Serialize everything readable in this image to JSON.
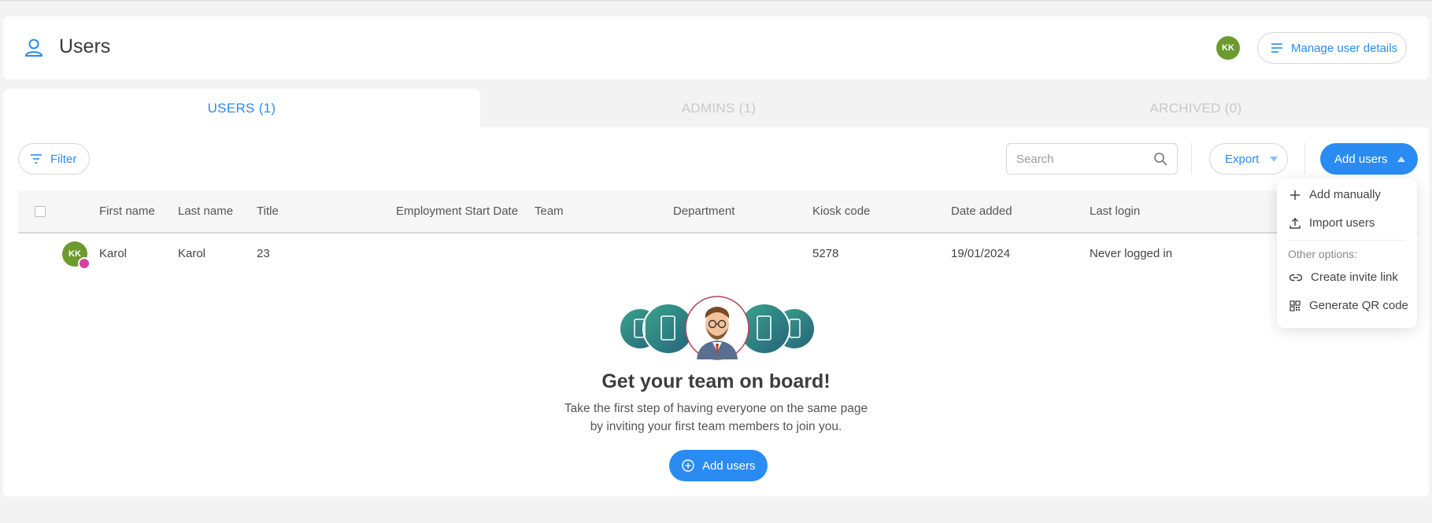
{
  "header": {
    "title": "Users",
    "avatar_initials": "KK",
    "manage_label": "Manage user details",
    "icon": "person-icon"
  },
  "tabs": [
    {
      "label": "USERS (1)",
      "active": true
    },
    {
      "label": "ADMINS (1)",
      "active": false
    },
    {
      "label": "ARCHIVED (0)",
      "active": false
    }
  ],
  "toolbar": {
    "filter_label": "Filter",
    "search_placeholder": "Search",
    "export_label": "Export",
    "add_users_label": "Add users"
  },
  "table": {
    "columns": [
      "First name",
      "Last name",
      "Title",
      "Employment Start Date",
      "Team",
      "Department",
      "Kiosk code",
      "Date added",
      "Last login"
    ],
    "rows": [
      {
        "avatar_initials": "KK",
        "first_name": "Karol",
        "last_name": "Karol",
        "title": "23",
        "employment_start_date": "",
        "team": "",
        "department": "",
        "kiosk_code": "5278",
        "date_added": "19/01/2024",
        "last_login": "Never logged in"
      }
    ]
  },
  "empty_state": {
    "title": "Get your team on board!",
    "line1": "Take the first step of having everyone on the same page",
    "line2": "by inviting your first team members to join you.",
    "button_label": "Add users"
  },
  "dropdown": {
    "add_manually": "Add manually",
    "import_users": "Import users",
    "other_options": "Other options:",
    "create_invite_link": "Create invite link",
    "generate_qr_code": "Generate QR code"
  },
  "colors": {
    "accent": "#2a8bf2",
    "avatar": "#6c9a2f",
    "crown_badge": "#d63fa3",
    "illustration_teal": "#2e8e7e"
  }
}
